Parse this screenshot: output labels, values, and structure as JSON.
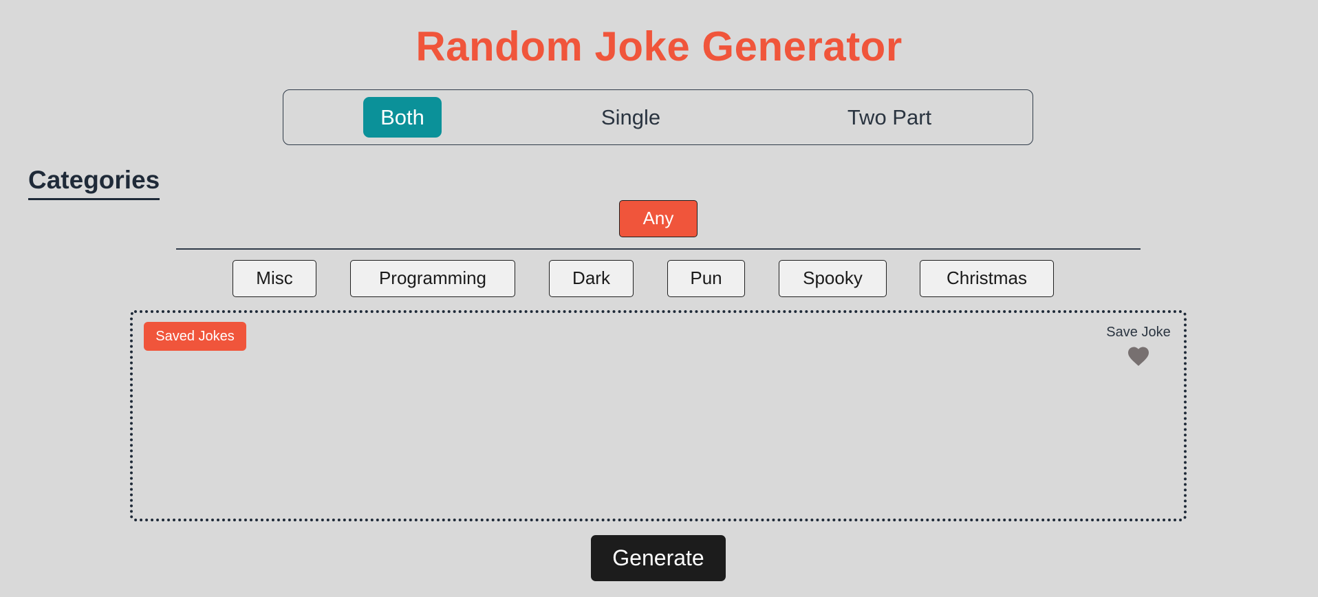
{
  "app": {
    "title": "Random Joke Generator"
  },
  "colors": {
    "accent": "#f0553b",
    "active_tab": "#0b9199",
    "background": "#d9d9d9",
    "dark": "#1c1c1c",
    "heart": "#777070"
  },
  "joke_type": {
    "options": [
      "Both",
      "Single",
      "Two Part"
    ],
    "selected": "Both"
  },
  "categories": {
    "heading": "Categories",
    "any_label": "Any",
    "items": [
      "Misc",
      "Programming",
      "Dark",
      "Pun",
      "Spooky",
      "Christmas"
    ]
  },
  "joke_box": {
    "saved_jokes_label": "Saved Jokes",
    "save_joke_label": "Save Joke",
    "save_icon": "heart-icon",
    "joke_text": ""
  },
  "actions": {
    "generate_label": "Generate"
  }
}
